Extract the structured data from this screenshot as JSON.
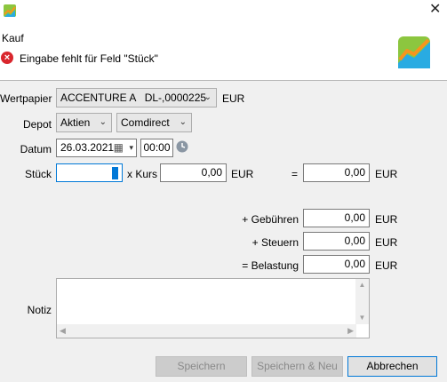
{
  "window": {
    "close_glyph": "✕"
  },
  "header": {
    "title": "Kauf",
    "error_message": "Eingabe fehlt für Feld \"Stück\""
  },
  "form": {
    "wertpapier": {
      "label": "Wertpapier",
      "value": "ACCENTURE A   DL-,0000225",
      "currency": "EUR"
    },
    "depot": {
      "label": "Depot",
      "portfolio": "Aktien",
      "account": "Comdirect"
    },
    "datum": {
      "label": "Datum",
      "date": "26.03.2021",
      "time": "00:00"
    },
    "stueck": {
      "label": "Stück",
      "value": "",
      "kurs_label": "x Kurs",
      "kurs_value": "0,00",
      "kurs_currency": "EUR",
      "equals": "=",
      "total_value": "0,00",
      "total_currency": "EUR"
    },
    "gebuehren": {
      "label": "+ Gebühren",
      "value": "0,00",
      "currency": "EUR"
    },
    "steuern": {
      "label": "+ Steuern",
      "value": "0,00",
      "currency": "EUR"
    },
    "belastung": {
      "label": "= Belastung",
      "value": "0,00",
      "currency": "EUR"
    },
    "notiz": {
      "label": "Notiz",
      "value": ""
    }
  },
  "buttons": {
    "save": "Speichern",
    "save_new": "Speichern & Neu",
    "cancel": "Abbrechen"
  },
  "colors": {
    "error": "#d9262d",
    "focus": "#0078d7"
  }
}
